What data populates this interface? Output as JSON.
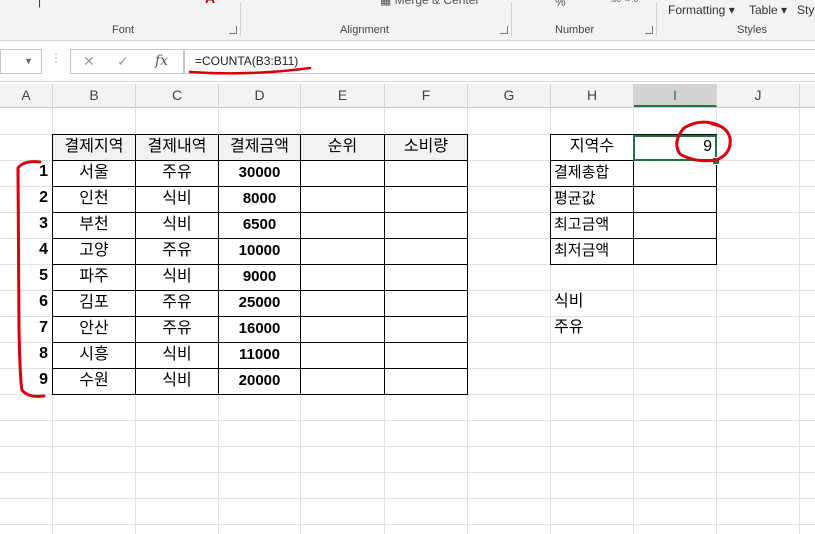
{
  "ribbon": {
    "groups": [
      "Font",
      "Alignment",
      "Number",
      "Styles"
    ],
    "styles_buttons": [
      "Formatting",
      "Table",
      "Styl"
    ]
  },
  "formula_bar": {
    "formula": "=COUNTA(B3:B11)",
    "fx_symbol": "fx"
  },
  "columns": [
    "A",
    "B",
    "C",
    "D",
    "E",
    "F",
    "G",
    "H",
    "I",
    "J"
  ],
  "active_column": "I",
  "table": {
    "headers": [
      "결제지역",
      "결제내역",
      "결제금액",
      "순위",
      "소비량"
    ],
    "rows": [
      {
        "num": "1",
        "region": "서울",
        "item": "주유",
        "amount": "30000"
      },
      {
        "num": "2",
        "region": "인천",
        "item": "식비",
        "amount": "8000"
      },
      {
        "num": "3",
        "region": "부천",
        "item": "식비",
        "amount": "6500"
      },
      {
        "num": "4",
        "region": "고양",
        "item": "주유",
        "amount": "10000"
      },
      {
        "num": "5",
        "region": "파주",
        "item": "식비",
        "amount": "9000"
      },
      {
        "num": "6",
        "region": "김포",
        "item": "주유",
        "amount": "25000"
      },
      {
        "num": "7",
        "region": "안산",
        "item": "주유",
        "amount": "16000"
      },
      {
        "num": "8",
        "region": "시흥",
        "item": "식비",
        "amount": "11000"
      },
      {
        "num": "9",
        "region": "수원",
        "item": "식비",
        "amount": "20000"
      }
    ]
  },
  "summary": {
    "labels": [
      "지역수",
      "결제총합",
      "평균값",
      "최고금액",
      "최저금액"
    ],
    "count_value": "9"
  },
  "categories": [
    "식비",
    "주유"
  ],
  "colors": {
    "accent": "#217346",
    "annotation": "#d9000d"
  }
}
